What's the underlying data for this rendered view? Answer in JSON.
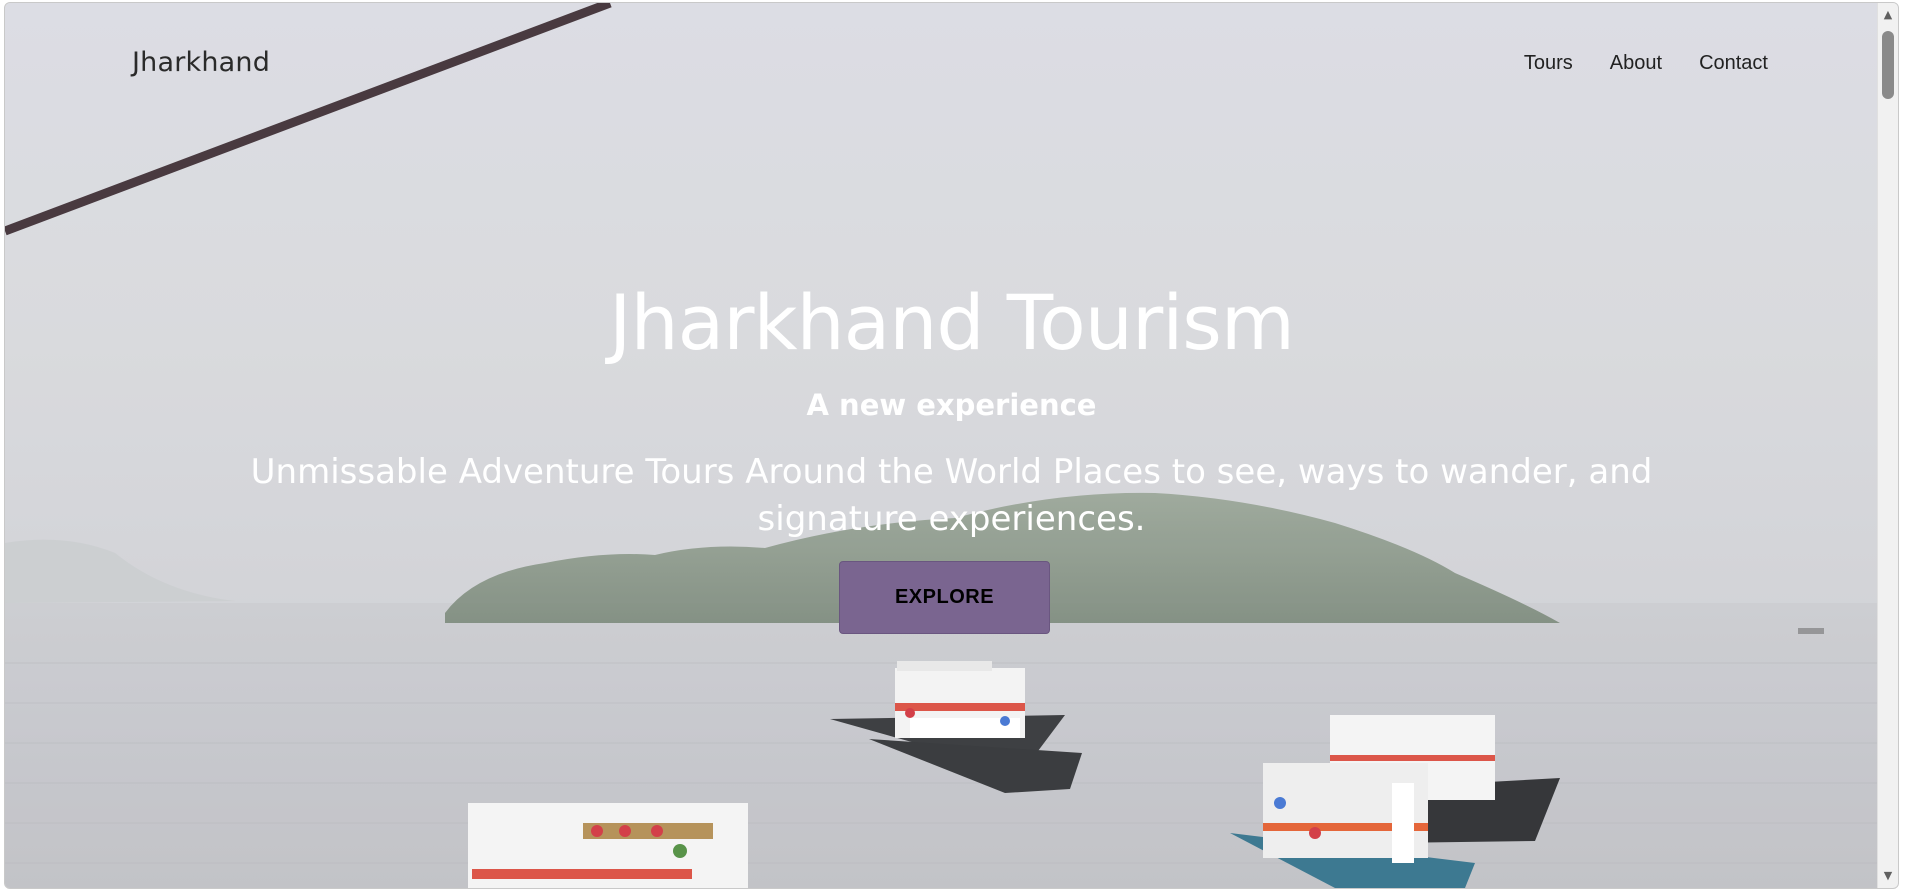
{
  "nav": {
    "brand": "Jharkhand",
    "links": [
      "Tours",
      "About",
      "Contact"
    ]
  },
  "hero": {
    "title": "Jharkhand Tourism",
    "subtitle": "A new experience",
    "description": "Unmissable Adventure Tours Around the World Places to see, ways to wander, and signature experiences.",
    "cta_label": "EXPLORE",
    "cta_color": "#7a6590"
  },
  "icons": {
    "scroll_up": "scroll-up-arrow",
    "scroll_down": "scroll-down-arrow"
  }
}
